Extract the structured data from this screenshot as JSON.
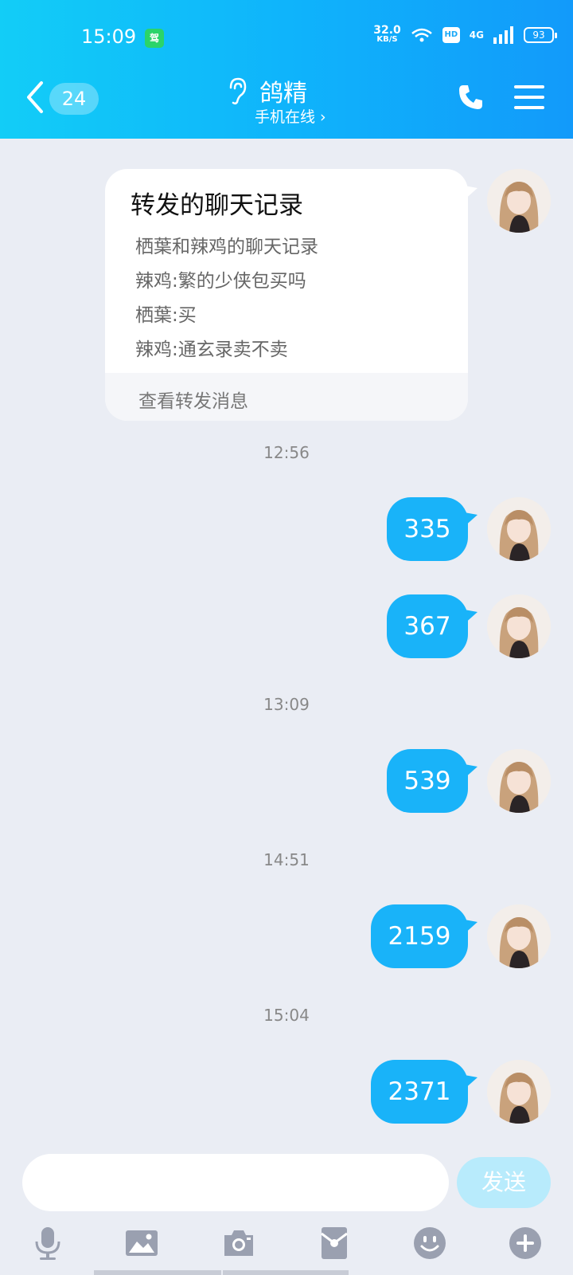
{
  "status_bar": {
    "time": "15:09",
    "app_icon_label": "驾",
    "net_speed": "32.0",
    "net_unit": "KB/S",
    "hd": "HD",
    "signal": "4G",
    "battery": "93"
  },
  "header": {
    "unread_count": "24",
    "title": "鸽精",
    "subtitle": "手机在线 ›",
    "accent_color": "#12b0fa"
  },
  "forwarded_card": {
    "title": "转发的聊天记录",
    "lines": [
      "栖葉和辣鸡的聊天记录",
      "辣鸡:繁的少侠包买吗",
      "栖葉:买",
      "辣鸡:通玄录卖不卖"
    ],
    "footer": "查看转发消息"
  },
  "messages": [
    {
      "type": "timestamp",
      "text": "12:56"
    },
    {
      "type": "bubble",
      "text": "335"
    },
    {
      "type": "bubble",
      "text": "367"
    },
    {
      "type": "timestamp",
      "text": "13:09"
    },
    {
      "type": "bubble",
      "text": "539"
    },
    {
      "type": "timestamp",
      "text": "14:51"
    },
    {
      "type": "bubble",
      "text": "2159"
    },
    {
      "type": "timestamp",
      "text": "15:04"
    },
    {
      "type": "bubble",
      "text": "2371"
    }
  ],
  "input": {
    "placeholder": "",
    "send_label": "发送"
  },
  "toolbar": [
    "microphone-icon",
    "image-icon",
    "camera-icon",
    "red-packet-icon",
    "emoji-icon",
    "plus-icon"
  ]
}
